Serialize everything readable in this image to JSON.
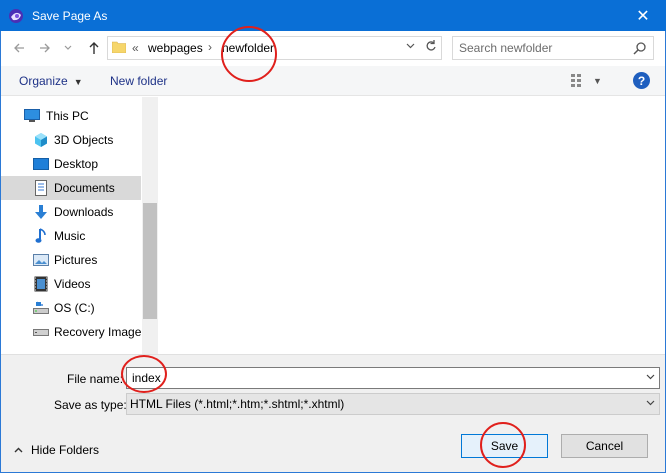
{
  "window": {
    "title": "Save Page As",
    "close_glyph": "✕"
  },
  "address": {
    "chevrons": "«",
    "crumbs": [
      "webpages",
      "newfolder"
    ],
    "separator": "›"
  },
  "search": {
    "placeholder": "Search newfolder"
  },
  "toolbar": {
    "organize_label": "Organize",
    "new_folder_label": "New folder",
    "help_glyph": "?"
  },
  "sidebar": {
    "items": [
      {
        "label": "This PC",
        "icon": "computer-icon"
      },
      {
        "label": "3D Objects",
        "icon": "cube-icon"
      },
      {
        "label": "Desktop",
        "icon": "desktop-icon"
      },
      {
        "label": "Documents",
        "icon": "documents-icon",
        "selected": true
      },
      {
        "label": "Downloads",
        "icon": "download-arrow-icon"
      },
      {
        "label": "Music",
        "icon": "music-note-icon"
      },
      {
        "label": "Pictures",
        "icon": "pictures-icon"
      },
      {
        "label": "Videos",
        "icon": "film-icon"
      },
      {
        "label": "OS (C:)",
        "icon": "drive-icon"
      },
      {
        "label": "Recovery Image",
        "icon": "drive-icon"
      }
    ]
  },
  "form": {
    "file_name_label": "File name:",
    "file_name_value": "index",
    "save_type_label": "Save as type:",
    "save_type_value": "HTML Files (*.html;*.htm;*.shtml;*.xhtml)"
  },
  "footer": {
    "hide_folders_label": "Hide Folders",
    "save_label": "Save",
    "cancel_label": "Cancel"
  },
  "colors": {
    "titlebar": "#0a6fd6",
    "annotation": "#e0201c",
    "link": "#1e3287"
  }
}
